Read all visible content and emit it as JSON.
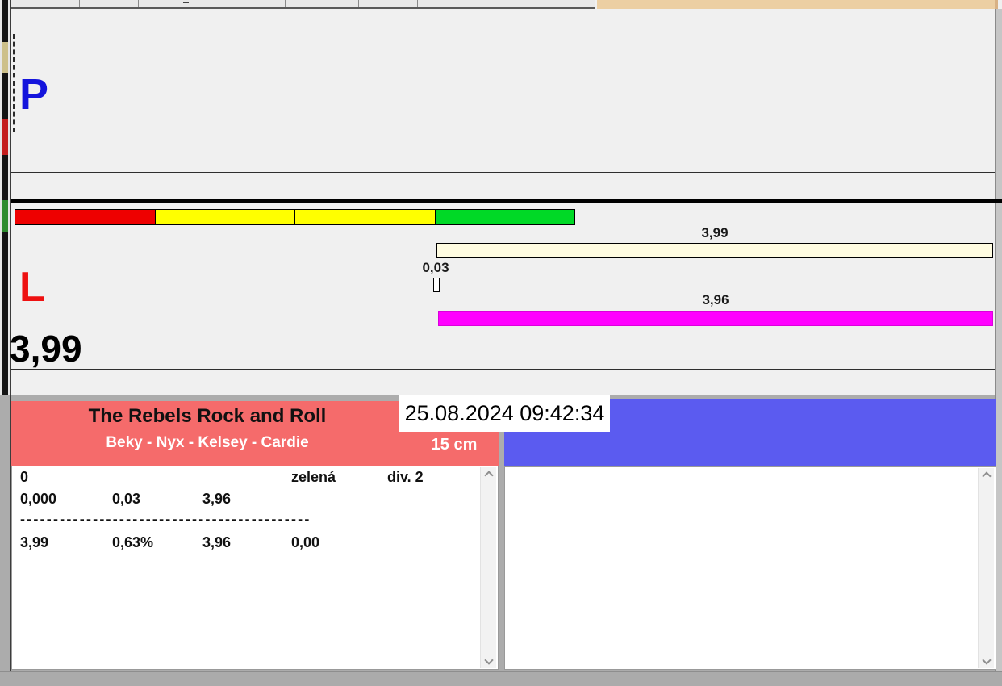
{
  "top_panel": {
    "label": "P"
  },
  "timing_panel": {
    "label": "L",
    "main_time": "3,99",
    "zone_colors": [
      "#ee0000",
      "#ffff00",
      "#ffff00",
      "#00d926"
    ],
    "upper_bar": {
      "label": "3,99",
      "value": 3.99,
      "color": "#fffce1"
    },
    "penalty_bar": {
      "label": "0,03",
      "value": 0.03,
      "color": "#ffffff"
    },
    "lower_bar": {
      "label": "3,96",
      "value": 3.96,
      "color": "#ff00ff"
    }
  },
  "team_panel": {
    "title": "The Rebels Rock and Roll",
    "members": "Beky - Nyx - Kelsey - Cardie",
    "datetime": "25.08.2024 09:42:34",
    "height_category": "15 cm",
    "results": {
      "row1": {
        "c1": "0",
        "c2": "zelená",
        "c3": "div. 2"
      },
      "row2": {
        "c1": "0,000",
        "c2": "0,03",
        "c3": "3,96"
      },
      "separator": "--------------------------------------------",
      "row3": {
        "c1": "3,99",
        "c2": "0,63%",
        "c3": "3,96",
        "c4": "0,00"
      }
    }
  },
  "colors": {
    "p_letter": "#1414dc",
    "l_letter": "#ee1111",
    "team_header": "#f56b6b",
    "right_header": "#5b5bf0",
    "top_accent": "#eccfa3",
    "sliver_tan": "#cdc08a",
    "sliver_red": "#c41e1e",
    "sliver_green": "#2e8b2e"
  }
}
